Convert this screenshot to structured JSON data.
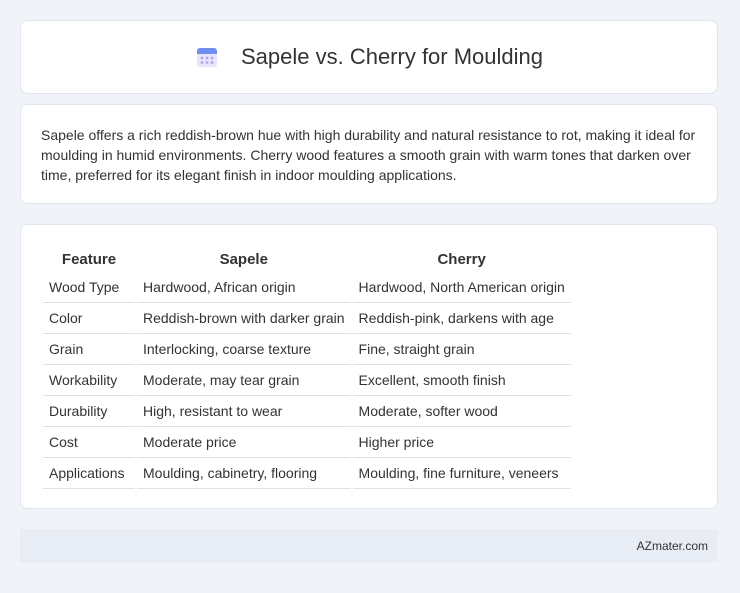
{
  "header": {
    "title": "Sapele vs. Cherry for Moulding",
    "icon": "calendar-icon"
  },
  "intro": {
    "text": "Sapele offers a rich reddish-brown hue with high durability and natural resistance to rot, making it ideal for moulding in humid environments. Cherry wood features a smooth grain with warm tones that darken over time, preferred for its elegant finish in indoor moulding applications."
  },
  "table": {
    "headers": [
      "Feature",
      "Sapele",
      "Cherry"
    ],
    "rows": [
      [
        "Wood Type",
        "Hardwood, African origin",
        "Hardwood, North American origin"
      ],
      [
        "Color",
        "Reddish-brown with darker grain",
        "Reddish-pink, darkens with age"
      ],
      [
        "Grain",
        "Interlocking, coarse texture",
        "Fine, straight grain"
      ],
      [
        "Workability",
        "Moderate, may tear grain",
        "Excellent, smooth finish"
      ],
      [
        "Durability",
        "High, resistant to wear",
        "Moderate, softer wood"
      ],
      [
        "Cost",
        "Moderate price",
        "Higher price"
      ],
      [
        "Applications",
        "Moulding, cabinetry, flooring",
        "Moulding, fine furniture, veneers"
      ]
    ]
  },
  "footer": {
    "brand": "AZmater.com"
  }
}
